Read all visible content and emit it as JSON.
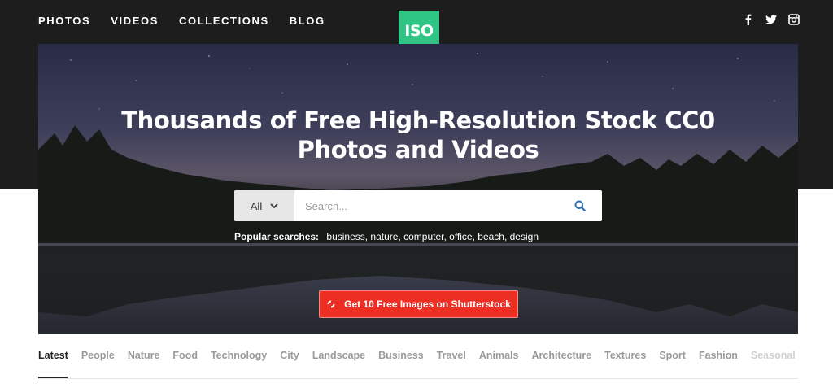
{
  "nav": {
    "items": [
      "PHOTOS",
      "VIDEOS",
      "COLLECTIONS",
      "BLOG"
    ]
  },
  "logo": {
    "text": "ISO",
    "color": "#2fc585"
  },
  "social": {
    "icons": [
      "facebook-icon",
      "twitter-icon",
      "instagram-icon"
    ]
  },
  "hero": {
    "title": "Thousands of Free High-Resolution Stock CC0 Photos and Videos"
  },
  "search": {
    "select_value": "All",
    "placeholder": "Search...",
    "value": ""
  },
  "popular": {
    "label": "Popular searches:",
    "terms": "business, nature, computer, office, beach, design"
  },
  "cta": {
    "label": "Get 10 Free Images on Shutterstock",
    "color": "#ed2f23"
  },
  "categories": [
    "Latest",
    "People",
    "Nature",
    "Food",
    "Technology",
    "City",
    "Landscape",
    "Business",
    "Travel",
    "Animals",
    "Architecture",
    "Textures",
    "Sport",
    "Fashion",
    "Seasonal"
  ]
}
